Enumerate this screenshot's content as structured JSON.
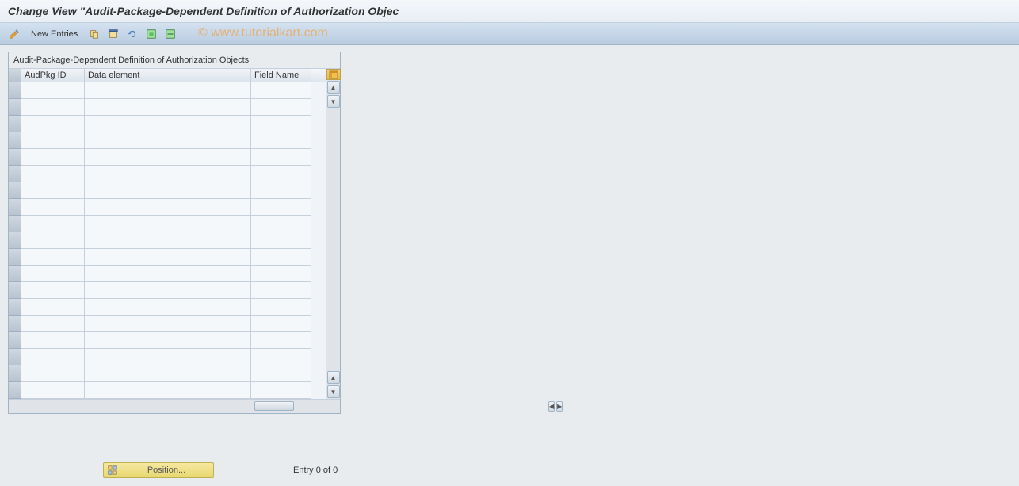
{
  "header": {
    "title": "Change View \"Audit-Package-Dependent Definition of Authorization Objec"
  },
  "toolbar": {
    "new_entries_label": "New Entries"
  },
  "watermark": "© www.tutorialkart.com",
  "table": {
    "caption": "Audit-Package-Dependent Definition of Authorization Objects",
    "columns": {
      "audpkg_id": "AudPkg ID",
      "data_element": "Data element",
      "field_name": "Field Name"
    },
    "row_count": 19
  },
  "footer": {
    "position_label": "Position...",
    "status": "Entry 0 of 0"
  }
}
